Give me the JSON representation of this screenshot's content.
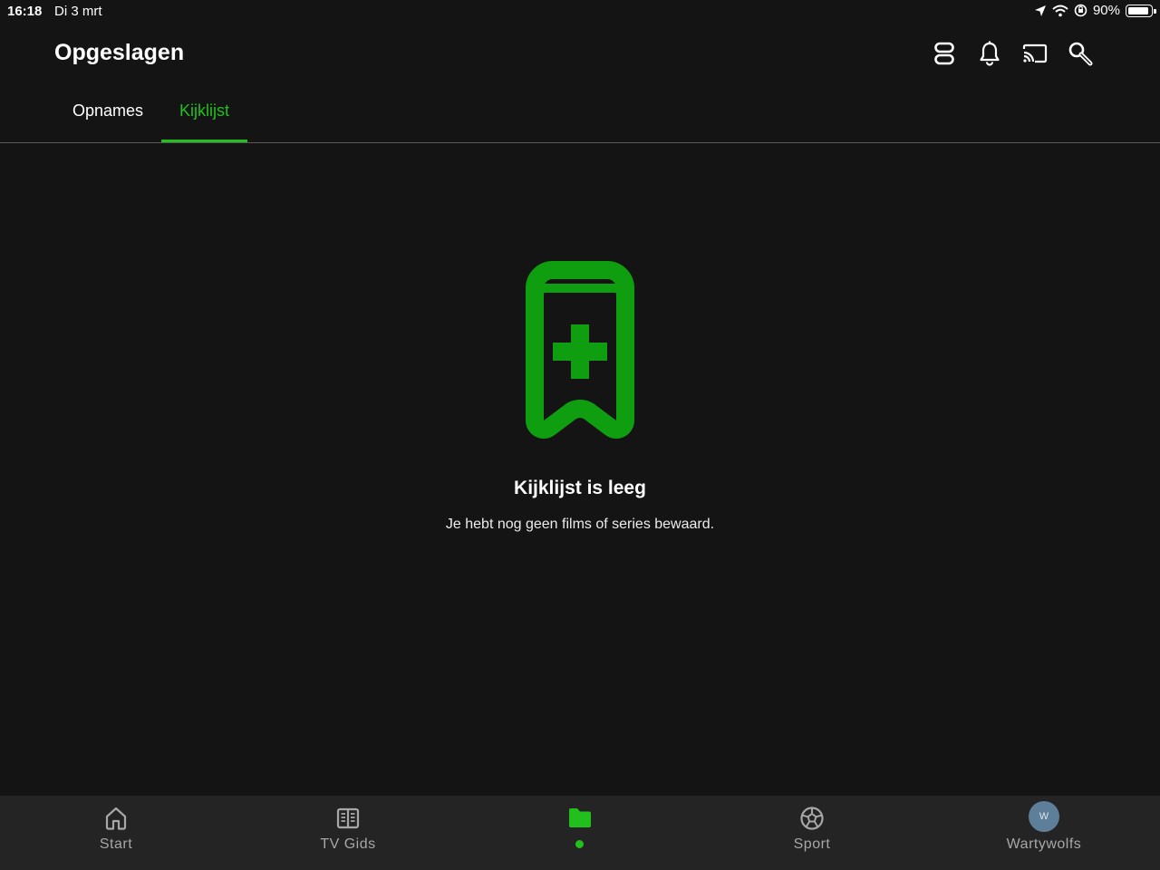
{
  "status_bar": {
    "time": "16:18",
    "date": "Di 3 mrt",
    "battery_percent": "90%",
    "battery_level": 0.9
  },
  "header": {
    "title": "Opgeslagen",
    "icons": [
      "storage-icon",
      "bell-icon",
      "cast-icon",
      "search-icon"
    ]
  },
  "tabs": [
    {
      "label": "Opnames",
      "active": false
    },
    {
      "label": "Kijklijst",
      "active": true
    }
  ],
  "empty_state": {
    "icon": "bookmark-add-icon",
    "title": "Kijklijst is leeg",
    "subtitle": "Je hebt nog geen films of series bewaard."
  },
  "bottom_nav": {
    "items": [
      {
        "label": "Start",
        "icon": "home-icon"
      },
      {
        "label": "TV Gids",
        "icon": "book-icon"
      },
      {
        "label": "",
        "icon": "folder-icon",
        "active": true
      },
      {
        "label": "Sport",
        "icon": "soccer-ball-icon"
      },
      {
        "label": "Wartywolfs",
        "icon": "avatar",
        "avatar_initial": "W"
      }
    ]
  },
  "colors": {
    "accent": "#22c01c",
    "background": "#141414",
    "nav_background": "#242424",
    "avatar": "#5d7f9a"
  }
}
